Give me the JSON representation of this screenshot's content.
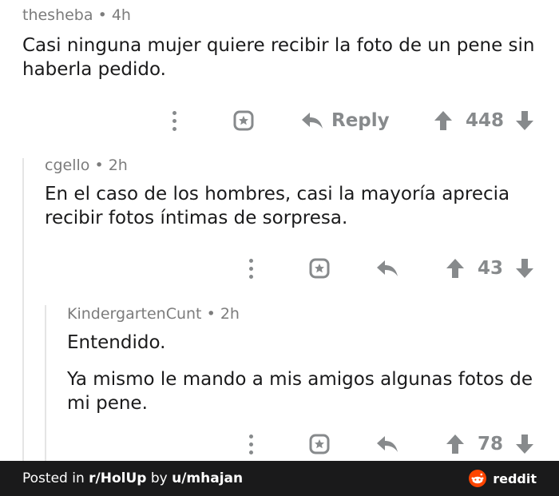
{
  "comments": [
    {
      "author": "thesheba",
      "separator": "•",
      "age": "4h",
      "text_lines": [
        "Casi ninguna mujer quiere recibir la foto de un pene sin",
        "haberla pedido."
      ],
      "reply_label": "Reply",
      "score": "448"
    },
    {
      "author": "cgello",
      "separator": "•",
      "age": "2h",
      "text_lines": [
        "En el caso de los hombres, casi la mayoría aprecia",
        "recibir fotos íntimas de sorpresa."
      ],
      "score": "43"
    },
    {
      "author": "KindergartenCunt",
      "separator": "•",
      "age": "2h",
      "text_lines": [
        "Entendido.",
        "",
        "Ya mismo le mando a mis amigos algunas fotos de",
        "mi pene."
      ],
      "score": "78"
    }
  ],
  "footer": {
    "posted_in": "Posted in",
    "subreddit": "r/HolUp",
    "by": "by",
    "user": "u/mhajan",
    "brand": "reddit"
  },
  "colors": {
    "text": "#1a1a1b",
    "meta": "#7c7c7c",
    "icon": "#878a8c",
    "footer_bg": "#1a1a1b",
    "reddit_orange": "#ff4500"
  }
}
